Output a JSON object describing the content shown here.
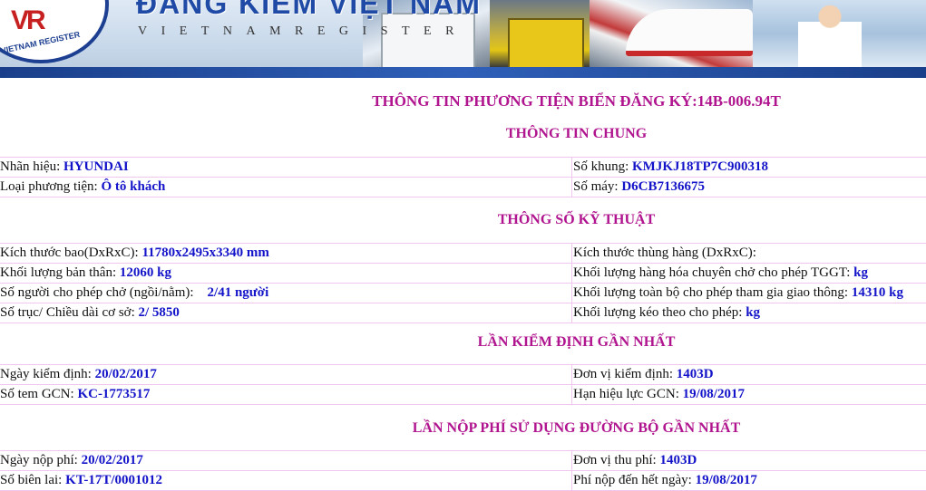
{
  "banner": {
    "brand": "ĐĂNG KIỂM VIỆT NAM",
    "brand_sub": "VIETNAMREGISTER",
    "logo_text": "VR",
    "logo_caption": "VIETNAM REGISTER"
  },
  "page_title": "THÔNG TIN PHƯƠNG TIỆN BIỂN ĐĂNG KÝ:14B-006.94T",
  "sections": {
    "general": {
      "title": "THÔNG TIN CHUNG",
      "rows": [
        {
          "l_label": "Nhãn hiệu: ",
          "l_value": "HYUNDAI",
          "r_label": "Số khung: ",
          "r_value": "KMJKJ18TP7C900318"
        },
        {
          "l_label": "Loại phương tiện: ",
          "l_value": "Ô tô khách",
          "r_label": "Số máy: ",
          "r_value": "D6CB7136675"
        }
      ]
    },
    "specs": {
      "title": "THÔNG SỐ KỸ THUẬT",
      "rows": [
        {
          "l_label": "Kích thước bao(DxRxC): ",
          "l_value": "11780x2495x3340 mm",
          "r_label": "Kích thước thùng hàng (DxRxC): ",
          "r_value": ""
        },
        {
          "l_label": "Khối lượng bản thân: ",
          "l_value": "12060 kg",
          "r_label": "Khối lượng hàng hóa chuyên chở cho phép TGGT: ",
          "r_value": "kg"
        },
        {
          "l_label": "Số người cho phép chở (ngồi/nằm):    ",
          "l_value": "2/41 người",
          "r_label": "Khối lượng toàn bộ cho phép tham gia giao thông: ",
          "r_value": "14310 kg"
        },
        {
          "l_label": "Số trục/ Chiều dài cơ sở: ",
          "l_value": "2/ 5850",
          "r_label": "Khối lượng kéo theo cho phép: ",
          "r_value": "kg"
        }
      ]
    },
    "inspection": {
      "title": "LẦN KIỂM ĐỊNH GẦN NHẤT",
      "rows": [
        {
          "l_label": "Ngày kiểm định: ",
          "l_value": "20/02/2017",
          "r_label": "Đơn vị kiểm định: ",
          "r_value": "1403D"
        },
        {
          "l_label": "Số tem GCN: ",
          "l_value": "KC-1773517",
          "r_label": "Hạn hiệu lực GCN: ",
          "r_value": "19/08/2017"
        }
      ]
    },
    "fee": {
      "title": "LẦN NỘP PHÍ SỬ DỤNG ĐƯỜNG BỘ GẦN NHẤT",
      "rows": [
        {
          "l_label": "Ngày nộp phí: ",
          "l_value": "20/02/2017",
          "r_label": "Đơn vị thu phí: ",
          "r_value": "1403D"
        },
        {
          "l_label": "Số biên lai: ",
          "l_value": "KT-17T/0001012",
          "r_label": "Phí nộp đến hết ngày: ",
          "r_value": "19/08/2017"
        }
      ]
    }
  }
}
